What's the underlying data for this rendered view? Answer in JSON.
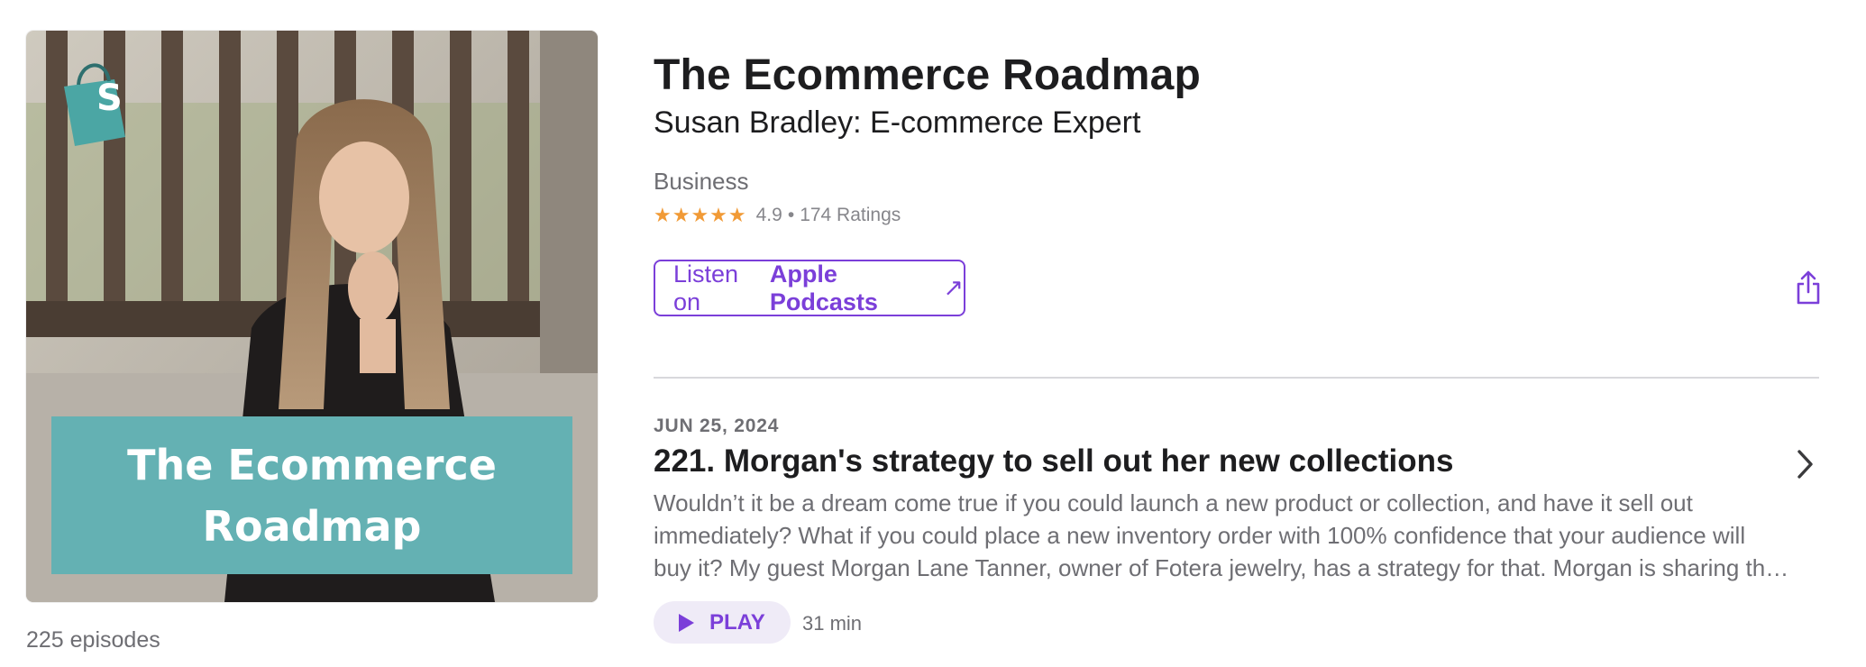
{
  "artwork": {
    "title_line1": "The Ecommerce",
    "title_line2": "Roadmap",
    "bag_letter": "S",
    "colors": {
      "teal": "#64b1b3",
      "bag": "#4ba6a4"
    }
  },
  "episode_count": "225 episodes",
  "show": {
    "title": "The Ecommerce Roadmap",
    "author": "Susan Bradley: E-commerce Expert",
    "category": "Business",
    "stars": "★★★★★",
    "rating": "4.9",
    "rating_separator": "•",
    "ratings_count": "174 Ratings"
  },
  "listen_button": {
    "prefix": "Listen on",
    "platform": "Apple Podcasts",
    "arrow": "↗",
    "icon": "external-arrow-icon"
  },
  "share": {
    "icon": "share-icon"
  },
  "episode": {
    "date": "JUN 25, 2024",
    "title": "221. Morgan's strategy to sell out her new collections",
    "description": "Wouldn’t it be a dream come true if you could launch a new product or collection, and have it sell out immediately? What if you could place a new inventory order with 100% confidence that your audience will buy it? My guest Morgan Lane Tanner, owner of Fotera jewelry, has a strategy for that. Morgan is sharing the exact process she uses to build anticipation before every launch.",
    "play_label": "PLAY",
    "duration": "31 min",
    "chevron_icon": "chevron-right-icon"
  },
  "colors": {
    "accent": "#7b3fd9",
    "star": "#f19a36",
    "secondary_text": "#6e6e73",
    "play_bg": "#efebf7"
  }
}
